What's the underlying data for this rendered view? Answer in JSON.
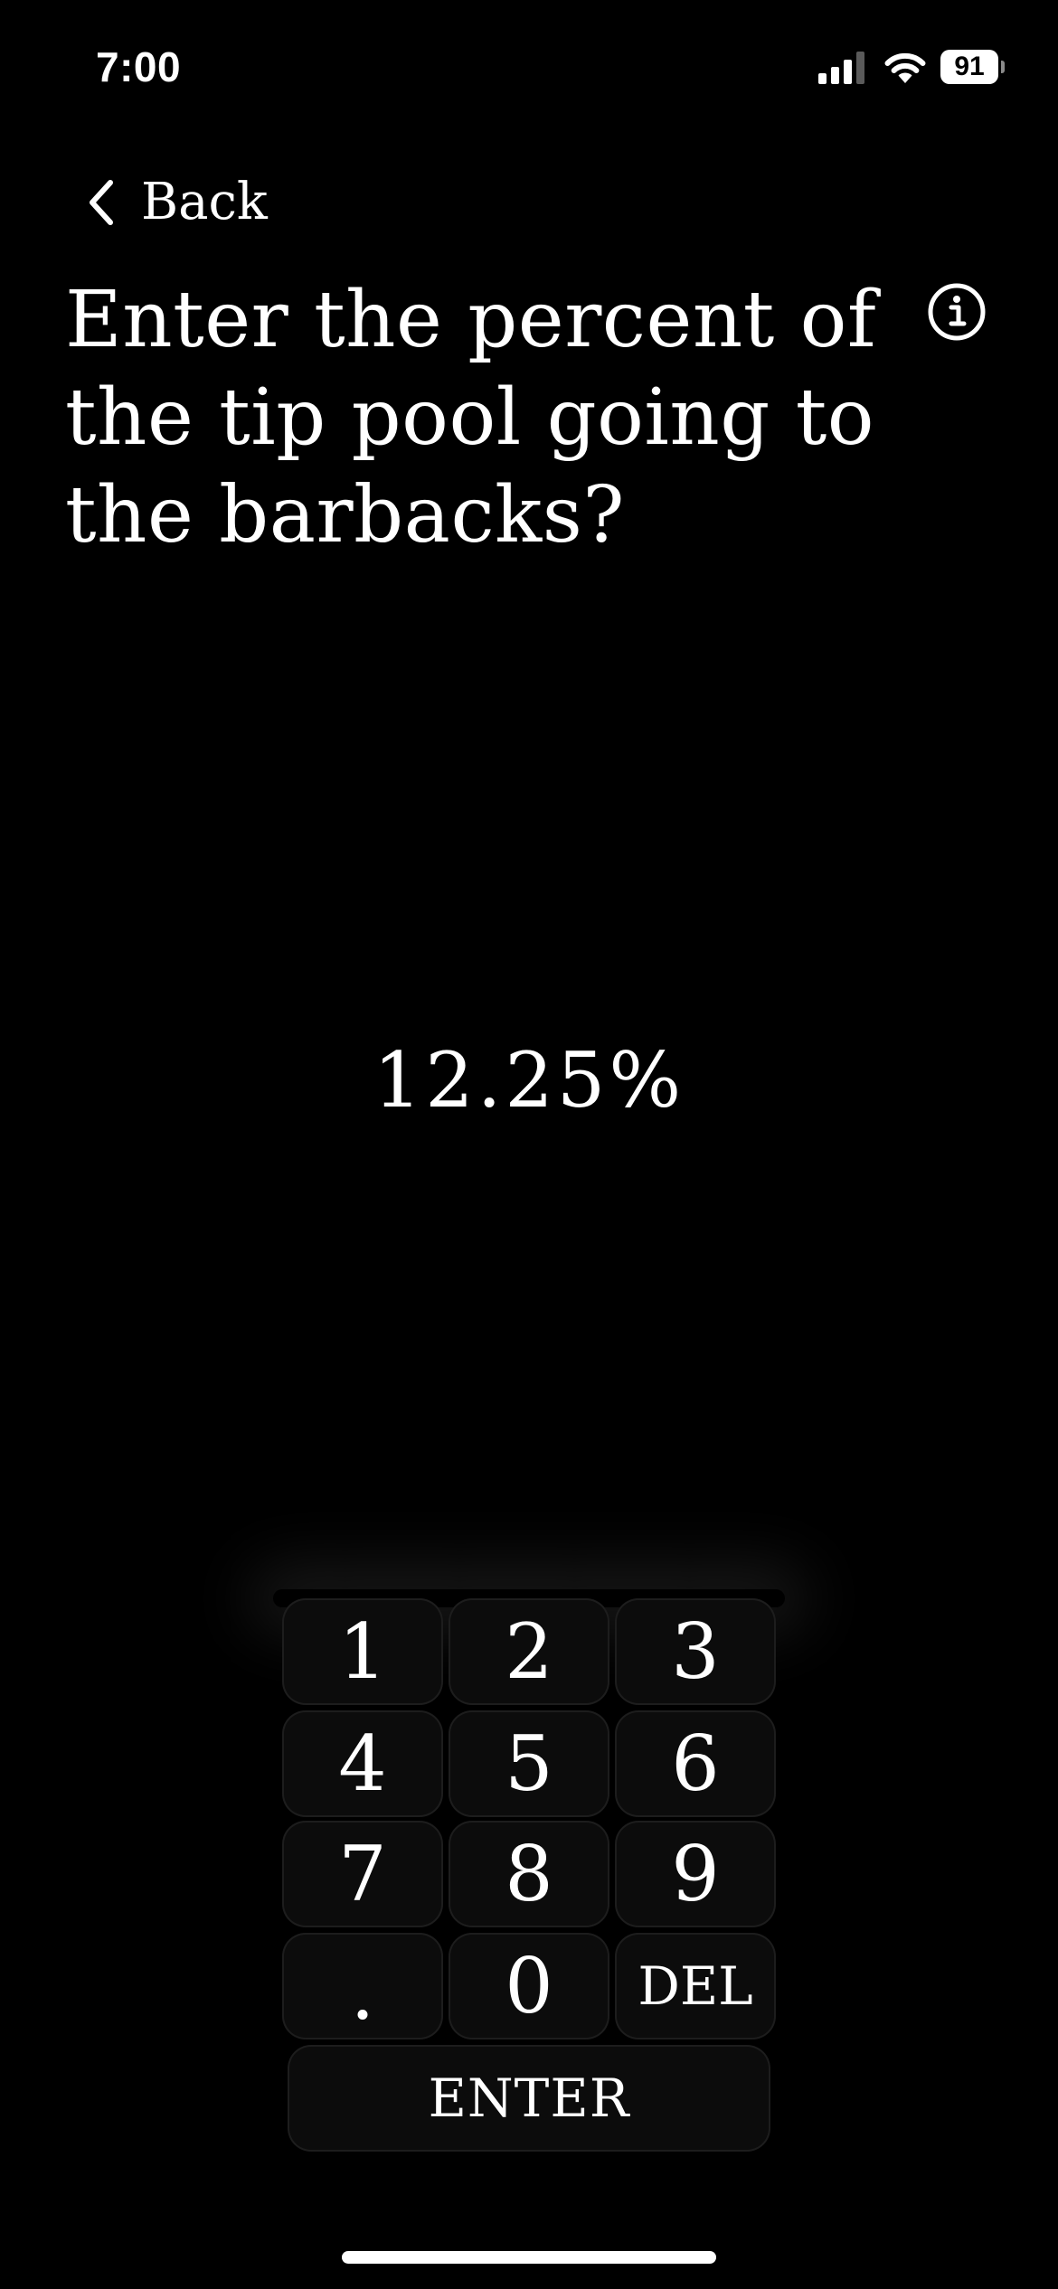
{
  "status_bar": {
    "time": "7:00",
    "battery_level": "91",
    "icons": [
      "cellular-signal-icon",
      "wifi-icon",
      "battery-icon"
    ]
  },
  "nav": {
    "back_label": "Back"
  },
  "question": {
    "text": "Enter the percent of the tip pool going to the barbacks?",
    "info_icon": "info-icon"
  },
  "input": {
    "value": "12.25%"
  },
  "keypad": {
    "keys": [
      "1",
      "2",
      "3",
      "4",
      "5",
      "6",
      "7",
      "8",
      "9",
      ".",
      "0",
      "DEL"
    ],
    "enter_label": "ENTER"
  },
  "colors": {
    "background": "#000000",
    "text": "#ffffff",
    "key_fill": "#0c0c0c"
  }
}
